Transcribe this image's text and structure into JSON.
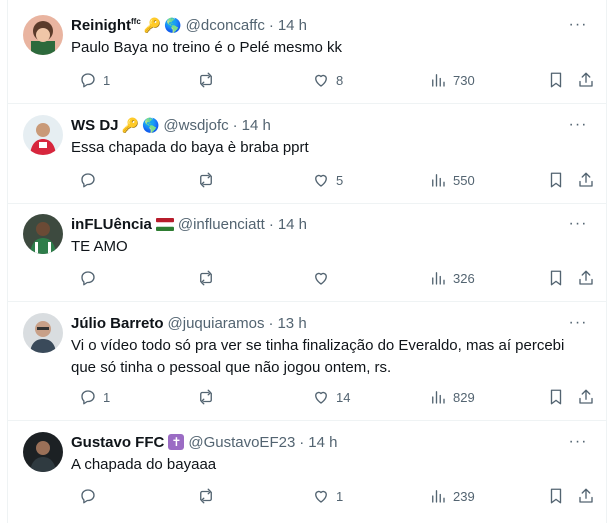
{
  "more_icon": "···",
  "colors": {
    "text": "#0f1419",
    "secondary": "#536471",
    "divider": "#eff3f4"
  },
  "tweets": [
    {
      "name": "Reinight",
      "name_sup": "ffc",
      "emojis": [
        "🔑",
        "🌎"
      ],
      "handle": "@dconcaffc",
      "dot": "·",
      "time": "14 h",
      "lines": [
        "Paulo Baya no treino é o Pelé mesmo kk"
      ],
      "reply_count": "1",
      "retweet_count": "",
      "like_count": "8",
      "view_count": "730"
    },
    {
      "name": "WS DJ",
      "emojis": [
        "🔑",
        "🌎"
      ],
      "handle": "@wsdjofc",
      "dot": "·",
      "time": "14 h",
      "lines": [
        "Essa chapada do baya è braba pprt"
      ],
      "reply_count": "",
      "retweet_count": "",
      "like_count": "5",
      "view_count": "550"
    },
    {
      "name": "inFLUência",
      "emojis": [],
      "handle": "@influenciatt",
      "dot": "·",
      "time": "14 h",
      "lines": [
        "TE AMO"
      ],
      "reply_count": "",
      "retweet_count": "",
      "like_count": "",
      "view_count": "326"
    },
    {
      "name": "Júlio Barreto",
      "emojis": [],
      "handle": "@juquiaramos",
      "dot": "·",
      "time": "13 h",
      "lines": [
        "Vi o vídeo todo só pra ver se tinha finalização do Everaldo, mas aí percebi",
        "que só tinha o pessoal que não jogou ontem, rs."
      ],
      "reply_count": "1",
      "retweet_count": "",
      "like_count": "14",
      "view_count": "829"
    },
    {
      "name": "Gustavo FFC",
      "emojis": [],
      "handle": "@GustavoEF23",
      "dot": "·",
      "time": "14 h",
      "lines": [
        "A chapada do bayaaa"
      ],
      "reply_count": "",
      "retweet_count": "",
      "like_count": "1",
      "view_count": "239"
    }
  ]
}
